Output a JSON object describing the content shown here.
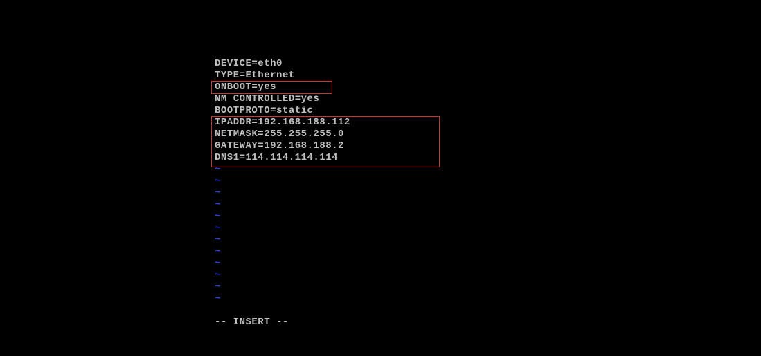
{
  "editor": {
    "lines": [
      "DEVICE=eth0",
      "TYPE=Ethernet",
      "ONBOOT=yes",
      "NM_CONTROLLED=yes",
      "BOOTPROTO=static",
      "IPADDR=192.168.188.112",
      "NETMASK=255.255.255.0",
      "GATEWAY=192.168.188.2",
      "DNS1=114.114.114.114"
    ],
    "empty_marker": "~",
    "empty_count": 12,
    "status": "-- INSERT --"
  }
}
